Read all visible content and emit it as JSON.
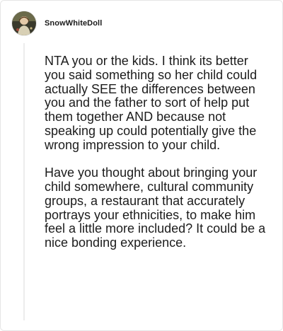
{
  "comment": {
    "username": "SnowWhiteDoll",
    "paragraphs": [
      "NTA you or the kids. I think its better you said something so her child could actually SEE the differences between you and the father to sort of help put them together AND because not speaking up could potentially give the wrong impression to your child.",
      "Have you thought about bringing your child somewhere, cultural community groups, a restaurant that accurately portrays your ethnicities, to make him feel a little more included? It could be a nice bonding experience."
    ]
  },
  "colors": {
    "text": "#1c1c1c",
    "border": "#e6e6e6",
    "thread_line": "#ececec",
    "background": "#ffffff"
  },
  "icons": {
    "avatar": "user-avatar"
  }
}
